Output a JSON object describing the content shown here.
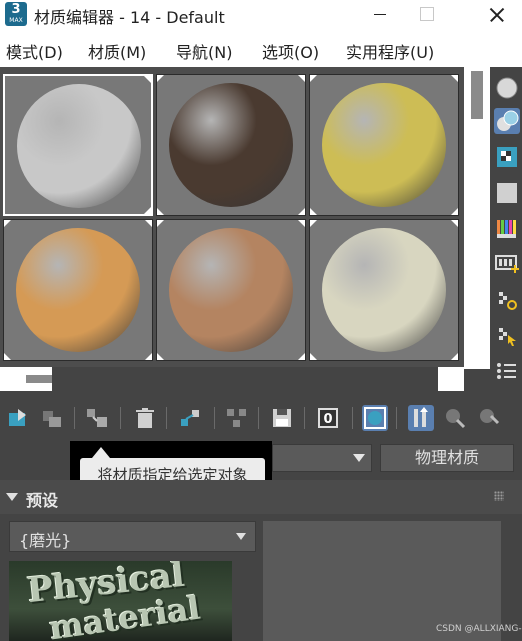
{
  "window": {
    "app_icon_number": "3",
    "app_icon_text": "MAX",
    "title": "材质编辑器 - 14 - Default"
  },
  "menu": [
    {
      "label": "模式(D)"
    },
    {
      "label": "材质(M)"
    },
    {
      "label": "导航(N)"
    },
    {
      "label": "选项(O)"
    },
    {
      "label": "实用程序(U)"
    }
  ],
  "sample_slots": [
    {
      "color": "#c8c8c8"
    },
    {
      "color": "#4a3a30"
    },
    {
      "color": "#cdbd55"
    },
    {
      "color": "#d59a55"
    },
    {
      "color": "#b48461"
    },
    {
      "color": "#d8d6c0"
    }
  ],
  "toolbar": {
    "material_id_value": "0"
  },
  "tooltip": {
    "text": "将材质指定给选定对象"
  },
  "material_type_button": "物理材质",
  "rollout": {
    "title": "预设",
    "preset_value": "{磨光}"
  },
  "preview_image_text": [
    "Physical",
    "material"
  ],
  "watermark": "CSDN @ALLXIANG-"
}
